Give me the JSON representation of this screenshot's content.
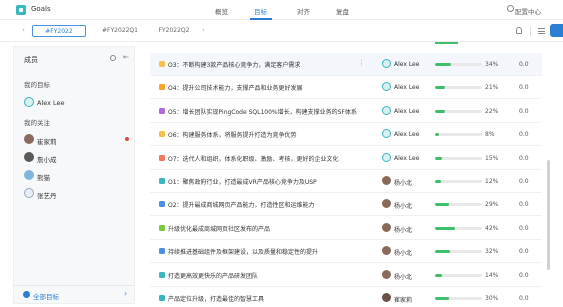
{
  "app": {
    "title": "Goals"
  },
  "nav": {
    "items": [
      {
        "label": "概览",
        "active": false
      },
      {
        "label": "目标",
        "active": true
      },
      {
        "label": "对齐",
        "active": false
      },
      {
        "label": "复盘",
        "active": false
      }
    ],
    "config_label": "配置中心"
  },
  "periods": {
    "tabs": [
      {
        "label": "#FY2022",
        "active": true
      },
      {
        "label": "#FY2022Q1",
        "active": false
      },
      {
        "label": "FY2022Q2",
        "active": false
      }
    ]
  },
  "sidebar": {
    "title": "成员",
    "my_goals_label": "我的目标",
    "me": {
      "name": "Alex Lee"
    },
    "following_label": "我的关注",
    "following": [
      {
        "name": "崔家莉",
        "unread": true
      },
      {
        "name": "詹小成",
        "unread": false
      },
      {
        "name": "熊猫",
        "unread": false
      },
      {
        "name": "张艺丹",
        "unread": false
      }
    ],
    "footer_label": "全部目标"
  },
  "goals": [
    {
      "title": "O3：不断构建3款产品核心竞争力，满足客户需求",
      "owner": "Alex Lee",
      "progress": 34,
      "progress_label": "34%",
      "score": "0.0",
      "color": "#f5c24a",
      "highlight": true
    },
    {
      "title": "O4：提升公司技术能力，支撑产品和业务更好发展",
      "owner": "Alex Lee",
      "progress": 21,
      "progress_label": "21%",
      "score": "0.0",
      "color": "#f5a623",
      "highlight": false
    },
    {
      "title": "O5：增长团队实现PingCode SQL100%增长，构建支撑业务的SF体系",
      "owner": "Alex Lee",
      "progress": 22,
      "progress_label": "22%",
      "score": "0.0",
      "color": "#b06ad9",
      "highlight": false
    },
    {
      "title": "O6：构建服务体系，将服务提升打造为竞争优势",
      "owner": "Alex Lee",
      "progress": 8,
      "progress_label": "8%",
      "score": "0.0",
      "color": "#f5c24a",
      "highlight": false
    },
    {
      "title": "O7：迭代人和组织，体系化职级、激励、考核，更好的企业文化",
      "owner": "Alex Lee",
      "progress": 15,
      "progress_label": "15%",
      "score": "0.0",
      "color": "#f07a5a",
      "highlight": false
    },
    {
      "title": "O1：聚焦政府行业，打造最成VR产品核心竞争力及USP",
      "owner": "杨小北",
      "progress": 12,
      "progress_label": "12%",
      "score": "0.0",
      "color": "#3ab6c0",
      "highlight": false
    },
    {
      "title": "O2：提升最成商城网页产品能力，打造性区和运维能力",
      "owner": "杨小北",
      "progress": 29,
      "progress_label": "29%",
      "score": "0.0",
      "color": "#4a90e2",
      "highlight": false
    },
    {
      "title": "升级优化最成商城网页社区发布的产品",
      "owner": "杨小北",
      "progress": 42,
      "progress_label": "42%",
      "score": "0.0",
      "color": "#7ac943",
      "highlight": false
    },
    {
      "title": "持续推进基础组件及框架建设，以及质量和稳定性的提升",
      "owner": "杨小北",
      "progress": 32,
      "progress_label": "32%",
      "score": "0.0",
      "color": "#4a90e2",
      "highlight": false
    },
    {
      "title": "打造更高效更快乐的产品研发团队",
      "owner": "杨小北",
      "progress": 14,
      "progress_label": "14%",
      "score": "0.0",
      "color": "#3ab6c0",
      "highlight": false
    },
    {
      "title": "产品定位升级，打造最佳的智慧工具",
      "owner": "崔家莉",
      "progress": 30,
      "progress_label": "30%",
      "score": "0.0",
      "color": "#3ab6c0",
      "highlight": false
    }
  ]
}
